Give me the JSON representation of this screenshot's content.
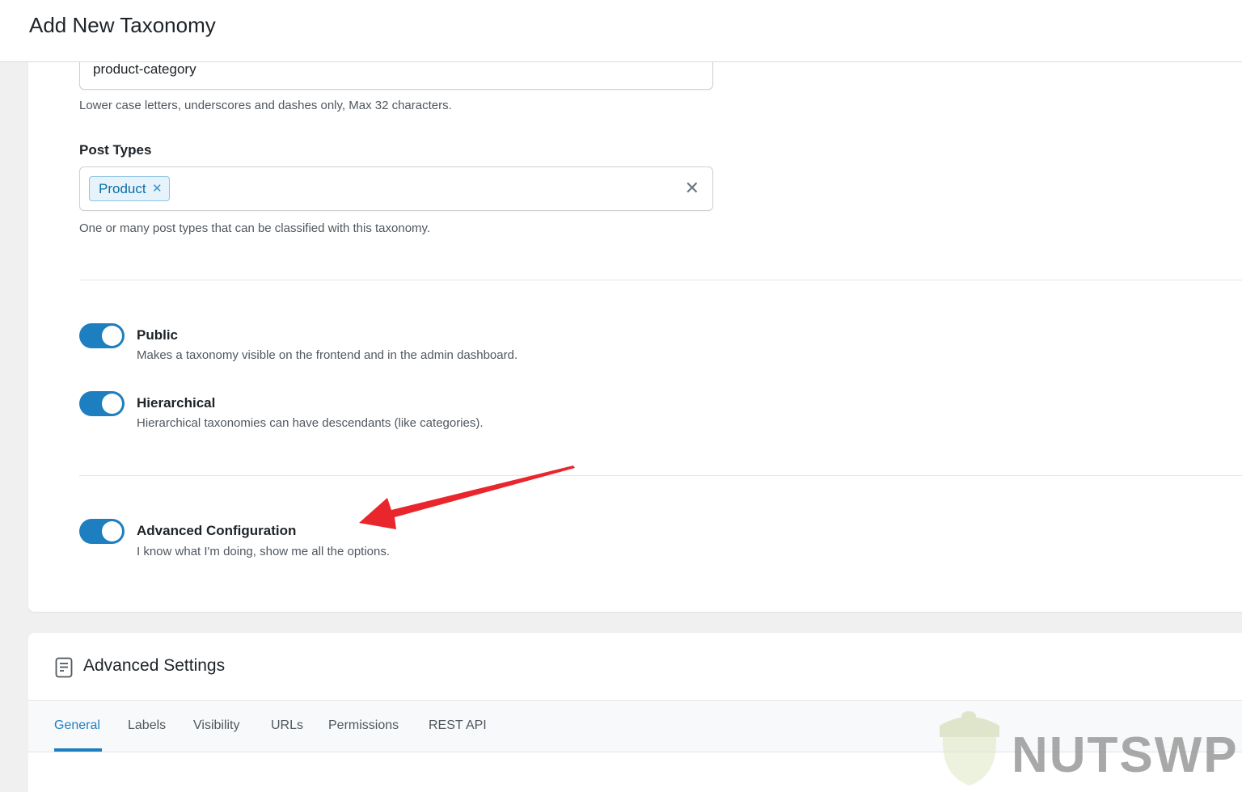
{
  "header": {
    "title": "Add New Taxonomy"
  },
  "slug_field": {
    "value": "product-category",
    "help": "Lower case letters, underscores and dashes only, Max 32 characters."
  },
  "post_types": {
    "label": "Post Types",
    "selected": [
      "Product"
    ],
    "chip_remove_glyph": "✕",
    "clear_glyph": "✕",
    "help": "One or many post types that can be classified with this taxonomy."
  },
  "toggles": [
    {
      "title": "Public",
      "description": "Makes a taxonomy visible on the frontend and in the admin dashboard.",
      "enabled": true
    },
    {
      "title": "Hierarchical",
      "description": "Hierarchical taxonomies can have descendants (like categories).",
      "enabled": true
    },
    {
      "title": "Advanced Configuration",
      "description": "I know what I'm doing, show me all the options.",
      "enabled": true
    }
  ],
  "annotation": {
    "arrow_color": "#e8262c"
  },
  "advanced_settings": {
    "title": "Advanced Settings",
    "icon": "document-icon",
    "tabs": [
      "General",
      "Labels",
      "Visibility",
      "URLs",
      "Permissions",
      "REST API"
    ],
    "active_tab": "General"
  },
  "watermark": {
    "text": "NUTSWP"
  },
  "colors": {
    "accent": "#1e7fc0",
    "chip_bg": "#e6f3fa",
    "chip_text": "#0a6ea6"
  }
}
